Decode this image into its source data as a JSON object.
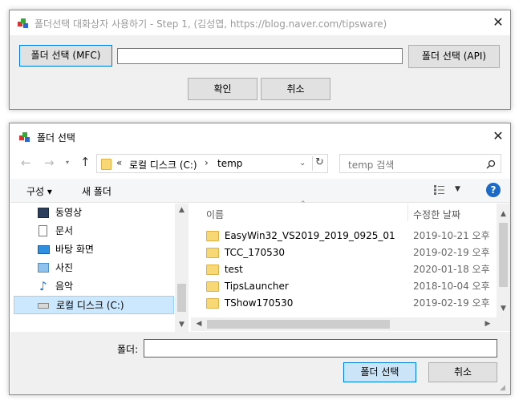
{
  "main_window": {
    "title": "폴더선택 대화상자 사용하기 - Step 1, (김성엽, https://blog.naver.com/tipsware)",
    "btn_mfc": "폴더 선택 (MFC)",
    "btn_api": "폴더 선택 (API)",
    "path_value": "",
    "btn_ok": "확인",
    "btn_cancel": "취소"
  },
  "dialog": {
    "title": "폴더 선택",
    "address": {
      "prefix": "«",
      "drive": "로컬 디스크 (C:)",
      "sep": "›",
      "folder": "temp"
    },
    "search_placeholder": "temp 검색",
    "toolbar": {
      "organize": "구성 ▾",
      "new_folder": "새 폴더"
    },
    "tree": [
      {
        "label": "동영상",
        "icon": "video-icon"
      },
      {
        "label": "문서",
        "icon": "document-icon"
      },
      {
        "label": "바탕 화면",
        "icon": "desktop-icon"
      },
      {
        "label": "사진",
        "icon": "pictures-icon"
      },
      {
        "label": "음악",
        "icon": "music-icon"
      },
      {
        "label": "로컬 디스크 (C:)",
        "icon": "drive-icon",
        "selected": true
      }
    ],
    "columns": {
      "name": "이름",
      "modified": "수정한 날짜"
    },
    "files": [
      {
        "name": "EasyWin32_VS2019_2019_0925_01",
        "date": "2019-10-21 오후"
      },
      {
        "name": "TCC_170530",
        "date": "2019-02-19 오후"
      },
      {
        "name": "test",
        "date": "2020-01-18 오후"
      },
      {
        "name": "TipsLauncher",
        "date": "2018-10-04 오후"
      },
      {
        "name": "TShow170530",
        "date": "2019-02-19 오후"
      }
    ],
    "folder_label": "폴더:",
    "folder_value": "",
    "btn_select": "폴더 선택",
    "btn_cancel": "취소"
  },
  "colors": {
    "accent": "#0078d7",
    "selection": "#cce8ff",
    "folder": "#f8d775"
  }
}
